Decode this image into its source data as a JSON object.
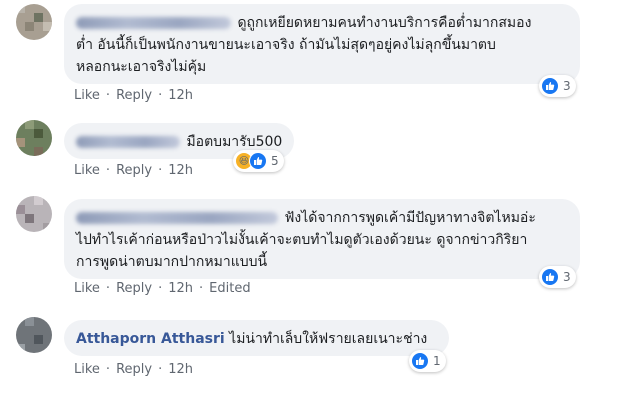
{
  "comments": [
    {
      "author": "",
      "text_lines": [
        "ดูถูกเหยียดหยามคนทำงานบริการคือต่ำมากสมอง",
        "ต่ำ อันนี้ก็เป็นพนักงานขายนะเอาจริง ถ้ามันไม่สุดๆอยู่คงไม่ลุกขึ้นมาตบ",
        "หลอกนะเอาจริงไม่คุ้ม"
      ],
      "actions": {
        "like": "Like",
        "reply": "Reply",
        "time": "12h"
      },
      "reaction_count": "3",
      "reaction_icons": [
        "like-icon"
      ]
    },
    {
      "author": "",
      "text_lines": [
        "มือตบมารับ500"
      ],
      "actions": {
        "like": "Like",
        "reply": "Reply",
        "time": "12h"
      },
      "reaction_count": "5",
      "reaction_icons": [
        "haha-icon",
        "like-icon"
      ]
    },
    {
      "author": "",
      "text_lines": [
        "ฟังได้จากการพูดเค้ามีปัญหาทางจิตไหมอ่ะ",
        "ไปทำไรเค้าก่อนหรือป่าวไม่งั้นเค้าจะตบทำไมดูตัวเองด้วยนะ ดูจากข่าวกิริยา",
        "การพูดน่าตบมากปากหมาแบบนี้"
      ],
      "actions": {
        "like": "Like",
        "reply": "Reply",
        "time": "12h",
        "edited": "Edited"
      },
      "reaction_count": "3",
      "reaction_icons": [
        "like-icon"
      ]
    },
    {
      "author": "Atthaporn Atthasri",
      "text_lines": [
        "ไม่น่าทำเล็บให้ฟรายเลยเนาะช่าง"
      ],
      "actions": {
        "like": "Like",
        "reply": "Reply",
        "time": "12h"
      },
      "reaction_count": "1",
      "reaction_icons": [
        "like-icon"
      ]
    }
  ],
  "colors": {
    "bubble": "#f0f2f5",
    "author": "#385898",
    "like_blue": "#1877f2",
    "meta": "#606770"
  }
}
